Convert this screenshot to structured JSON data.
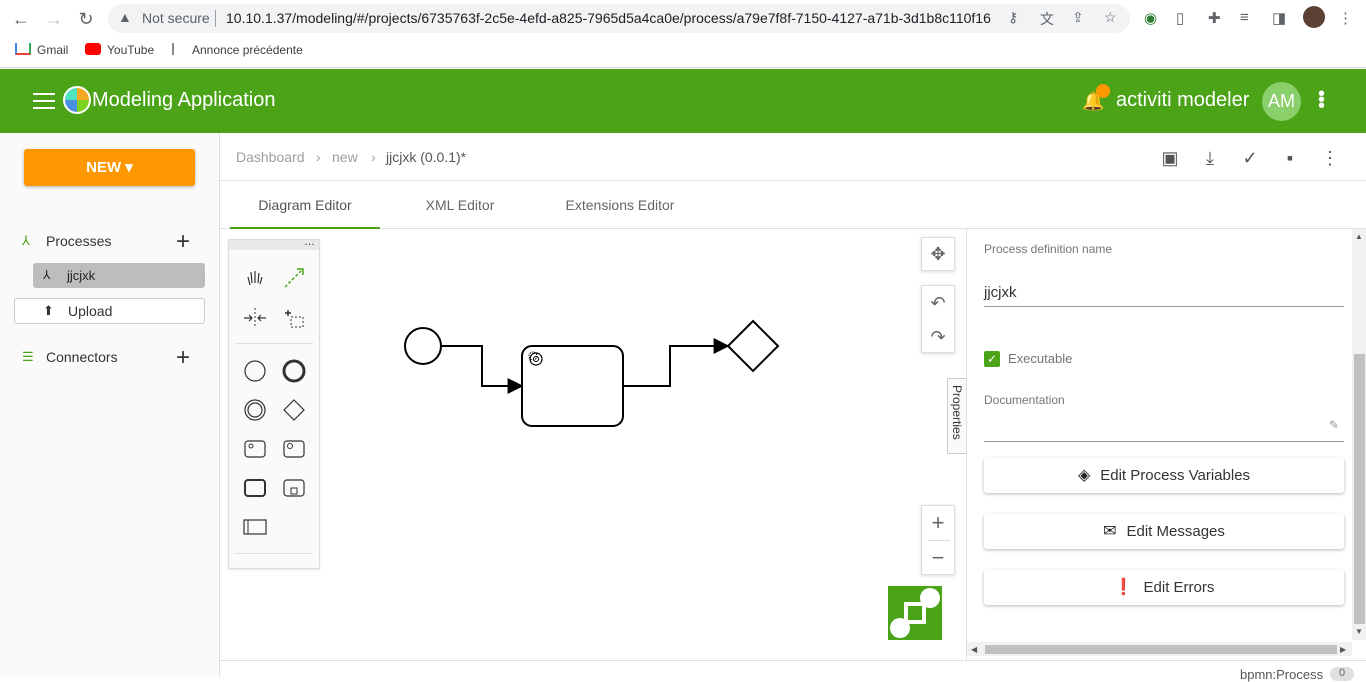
{
  "browser": {
    "security_label": "Not secure",
    "url": "10.10.1.37/modeling/#/projects/6735763f-2c5e-4efd-a825-7965d5a4ca0e/process/a79e7f8f-7150-4127-a71b-3d1b8c110f16",
    "bookmarks": [
      "Gmail",
      "YouTube",
      "Annonce précédente"
    ]
  },
  "header": {
    "app_title": "Modeling Application",
    "user_name": "activiti modeler",
    "user_initials": "AM",
    "accent_color": "#4ba318",
    "notification_color": "#ff9800"
  },
  "sidebar": {
    "new_label": "NEW",
    "processes_label": "Processes",
    "process_item": "jjcjxk",
    "upload_label": "Upload",
    "connectors_label": "Connectors"
  },
  "breadcrumb": {
    "items": [
      "Dashboard",
      "new",
      "jjcjxk (0.0.1)*"
    ]
  },
  "tabs": [
    "Diagram Editor",
    "XML Editor",
    "Extensions Editor"
  ],
  "canvas": {
    "properties_tab": "Properties"
  },
  "properties": {
    "name_label": "Process definition name",
    "name_value": "jjcjxk",
    "executable_label": "Executable",
    "documentation_label": "Documentation",
    "edit_variables": "Edit Process Variables",
    "edit_messages": "Edit Messages",
    "edit_errors": "Edit Errors"
  },
  "status": {
    "element_type": "bpmn:Process",
    "count": "0"
  }
}
